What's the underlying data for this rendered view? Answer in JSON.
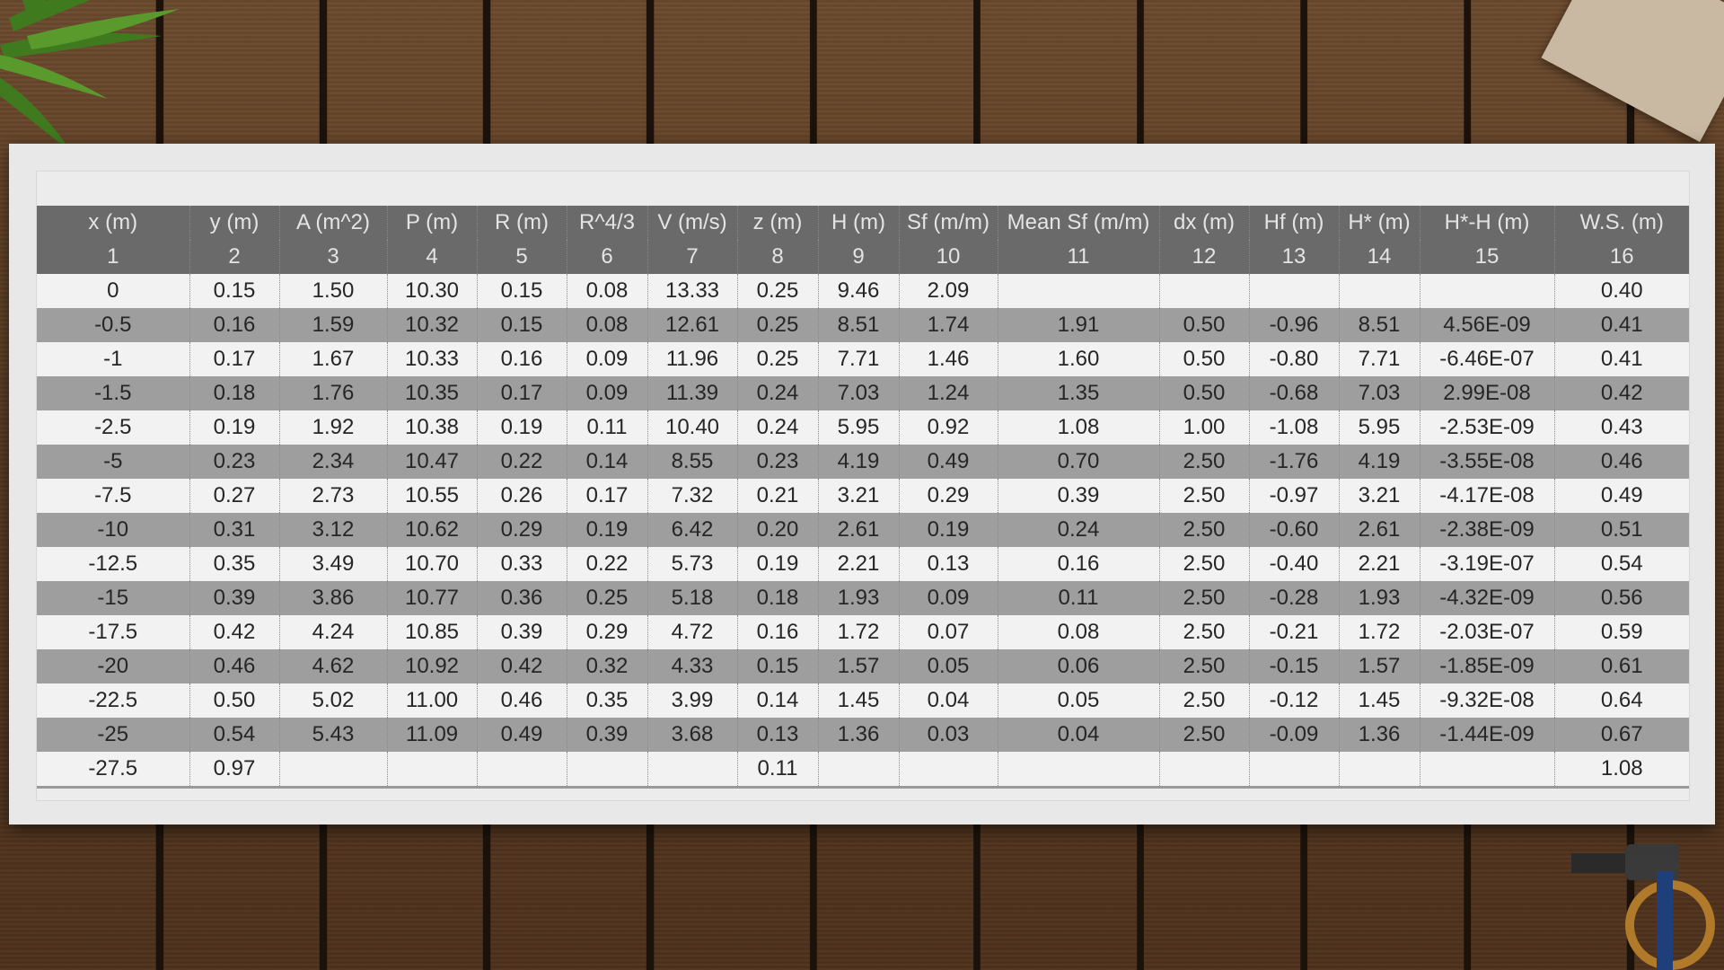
{
  "table": {
    "headers": [
      "x (m)",
      "y (m)",
      "A (m^2)",
      "P (m)",
      "R (m)",
      "R^4/3",
      "V (m/s)",
      "z (m)",
      "H (m)",
      "Sf (m/m)",
      "Mean Sf (m/m)",
      "dx (m)",
      "Hf (m)",
      "H* (m)",
      "H*-H (m)",
      "W.S. (m)"
    ],
    "column_numbers": [
      "1",
      "2",
      "3",
      "4",
      "5",
      "6",
      "7",
      "8",
      "9",
      "10",
      "11",
      "12",
      "13",
      "14",
      "15",
      "16"
    ],
    "rows": [
      [
        "0",
        "0.15",
        "1.50",
        "10.30",
        "0.15",
        "0.08",
        "13.33",
        "0.25",
        "9.46",
        "2.09",
        "",
        "",
        "",
        "",
        "",
        "0.40"
      ],
      [
        "-0.5",
        "0.16",
        "1.59",
        "10.32",
        "0.15",
        "0.08",
        "12.61",
        "0.25",
        "8.51",
        "1.74",
        "1.91",
        "0.50",
        "-0.96",
        "8.51",
        "4.56E-09",
        "0.41"
      ],
      [
        "-1",
        "0.17",
        "1.67",
        "10.33",
        "0.16",
        "0.09",
        "11.96",
        "0.25",
        "7.71",
        "1.46",
        "1.60",
        "0.50",
        "-0.80",
        "7.71",
        "-6.46E-07",
        "0.41"
      ],
      [
        "-1.5",
        "0.18",
        "1.76",
        "10.35",
        "0.17",
        "0.09",
        "11.39",
        "0.24",
        "7.03",
        "1.24",
        "1.35",
        "0.50",
        "-0.68",
        "7.03",
        "2.99E-08",
        "0.42"
      ],
      [
        "-2.5",
        "0.19",
        "1.92",
        "10.38",
        "0.19",
        "0.11",
        "10.40",
        "0.24",
        "5.95",
        "0.92",
        "1.08",
        "1.00",
        "-1.08",
        "5.95",
        "-2.53E-09",
        "0.43"
      ],
      [
        "-5",
        "0.23",
        "2.34",
        "10.47",
        "0.22",
        "0.14",
        "8.55",
        "0.23",
        "4.19",
        "0.49",
        "0.70",
        "2.50",
        "-1.76",
        "4.19",
        "-3.55E-08",
        "0.46"
      ],
      [
        "-7.5",
        "0.27",
        "2.73",
        "10.55",
        "0.26",
        "0.17",
        "7.32",
        "0.21",
        "3.21",
        "0.29",
        "0.39",
        "2.50",
        "-0.97",
        "3.21",
        "-4.17E-08",
        "0.49"
      ],
      [
        "-10",
        "0.31",
        "3.12",
        "10.62",
        "0.29",
        "0.19",
        "6.42",
        "0.20",
        "2.61",
        "0.19",
        "0.24",
        "2.50",
        "-0.60",
        "2.61",
        "-2.38E-09",
        "0.51"
      ],
      [
        "-12.5",
        "0.35",
        "3.49",
        "10.70",
        "0.33",
        "0.22",
        "5.73",
        "0.19",
        "2.21",
        "0.13",
        "0.16",
        "2.50",
        "-0.40",
        "2.21",
        "-3.19E-07",
        "0.54"
      ],
      [
        "-15",
        "0.39",
        "3.86",
        "10.77",
        "0.36",
        "0.25",
        "5.18",
        "0.18",
        "1.93",
        "0.09",
        "0.11",
        "2.50",
        "-0.28",
        "1.93",
        "-4.32E-09",
        "0.56"
      ],
      [
        "-17.5",
        "0.42",
        "4.24",
        "10.85",
        "0.39",
        "0.29",
        "4.72",
        "0.16",
        "1.72",
        "0.07",
        "0.08",
        "2.50",
        "-0.21",
        "1.72",
        "-2.03E-07",
        "0.59"
      ],
      [
        "-20",
        "0.46",
        "4.62",
        "10.92",
        "0.42",
        "0.32",
        "4.33",
        "0.15",
        "1.57",
        "0.05",
        "0.06",
        "2.50",
        "-0.15",
        "1.57",
        "-1.85E-09",
        "0.61"
      ],
      [
        "-22.5",
        "0.50",
        "5.02",
        "11.00",
        "0.46",
        "0.35",
        "3.99",
        "0.14",
        "1.45",
        "0.04",
        "0.05",
        "2.50",
        "-0.12",
        "1.45",
        "-9.32E-08",
        "0.64"
      ],
      [
        "-25",
        "0.54",
        "5.43",
        "11.09",
        "0.49",
        "0.39",
        "3.68",
        "0.13",
        "1.36",
        "0.03",
        "0.04",
        "2.50",
        "-0.09",
        "1.36",
        "-1.44E-09",
        "0.67"
      ],
      [
        "-27.5",
        "0.97",
        "",
        "",
        "",
        "",
        "",
        "0.11",
        "",
        "",
        "",
        "",
        "",
        "",
        "",
        "1.08"
      ]
    ]
  },
  "colors": {
    "header_bg": "#6a6a6a",
    "row_light": "#f2f2f2",
    "row_dark": "#9e9e9e",
    "wood": "#5a3b22"
  }
}
